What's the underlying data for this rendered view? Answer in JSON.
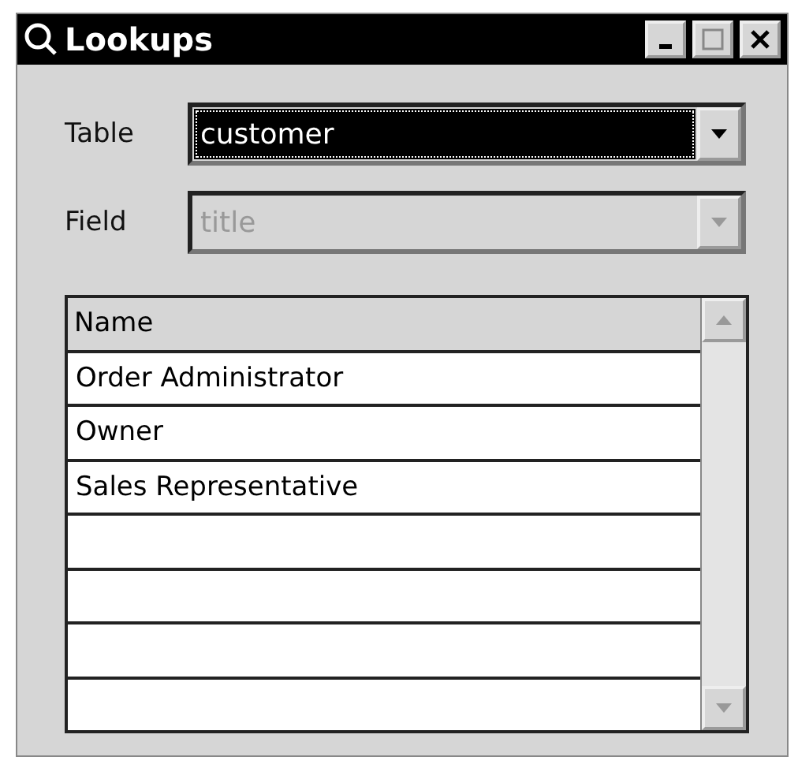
{
  "window": {
    "title": "Lookups"
  },
  "fields": [
    {
      "label": "Table",
      "value": "customer",
      "focused": true,
      "disabled": false
    },
    {
      "label": "Field",
      "value": "title",
      "focused": false,
      "disabled": true
    }
  ],
  "grid": {
    "columns": [
      "Name"
    ],
    "rows": [
      {
        "name": "Order Administrator"
      },
      {
        "name": "Owner"
      },
      {
        "name": "Sales Representative"
      }
    ]
  }
}
